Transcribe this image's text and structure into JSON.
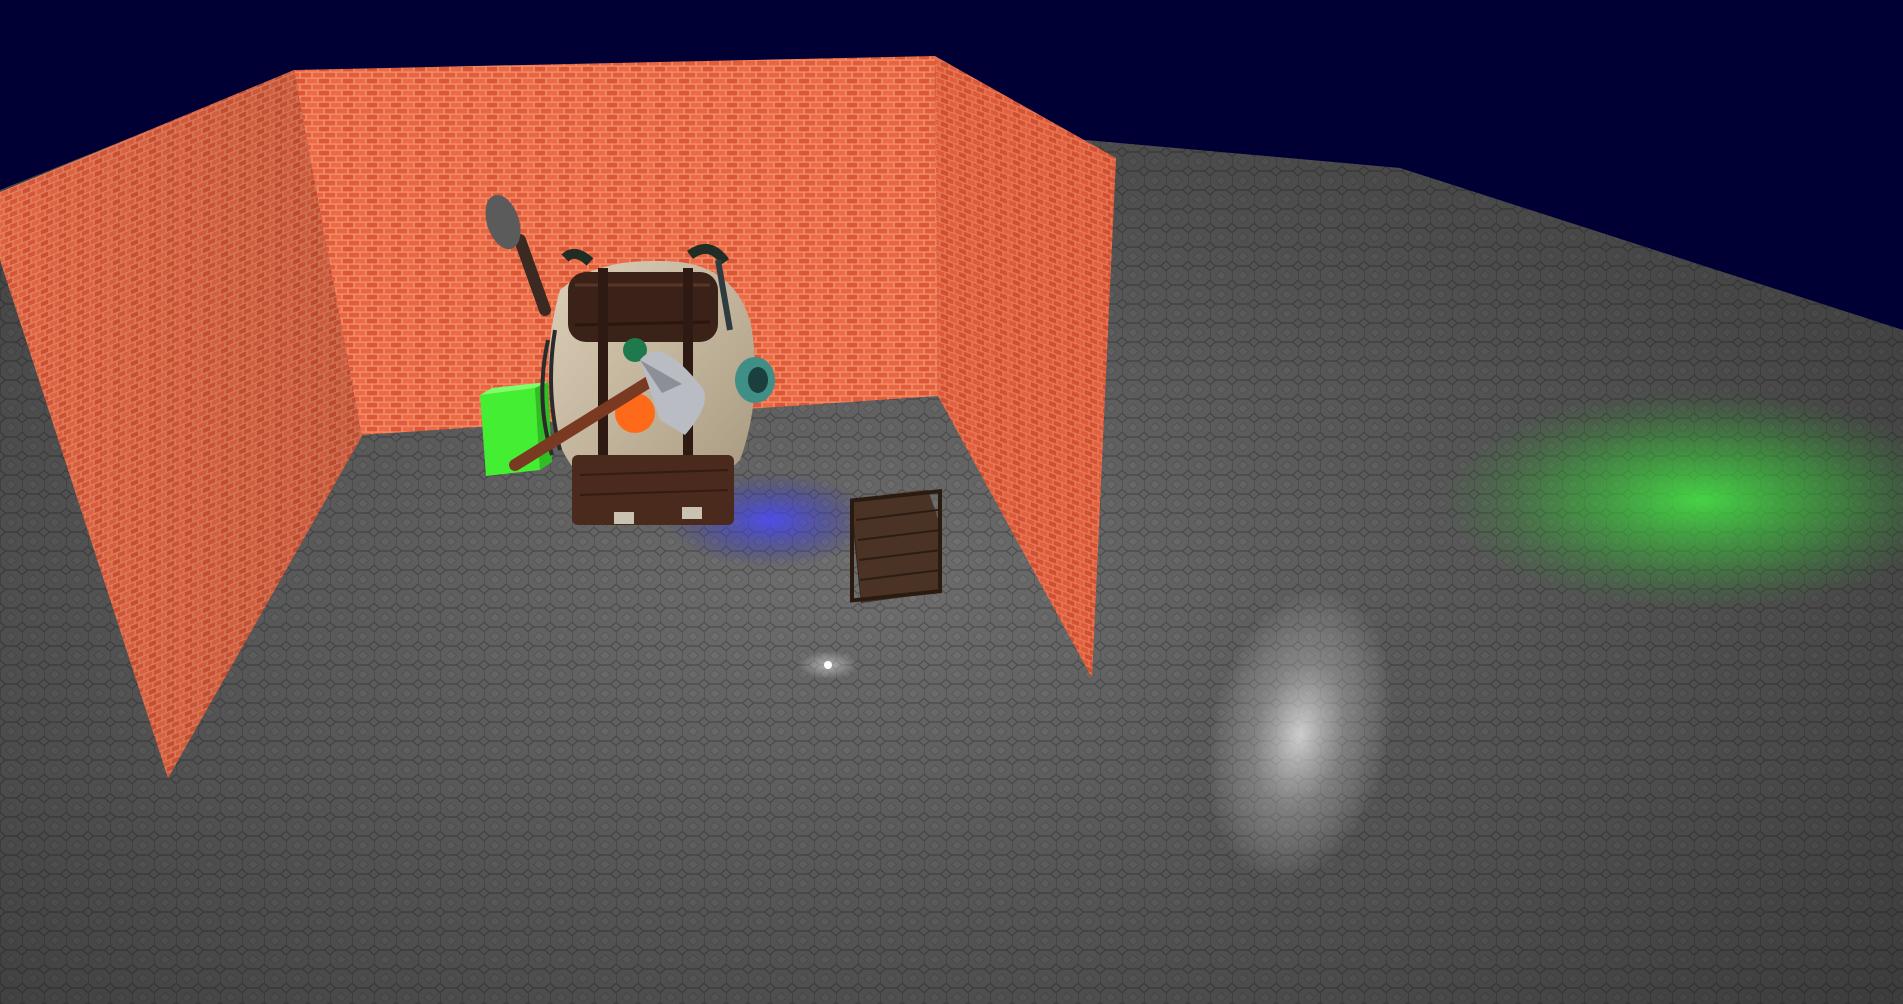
{
  "scene": {
    "sky_color": "#000035",
    "floor_color": "#6f6f6f",
    "floor_tile_color": "#5a5a5a",
    "brick_color": "#ee6440",
    "brick_mortar_color": "#f09a7c",
    "light_colors": {
      "blue": "#4a4aff",
      "green": "#44ff44",
      "white": "#ffffff"
    }
  },
  "objects": [
    {
      "name": "brick-wall-left",
      "kind": "wall"
    },
    {
      "name": "brick-wall-back",
      "kind": "wall"
    },
    {
      "name": "brick-wall-right",
      "kind": "wall"
    },
    {
      "name": "backpack-model",
      "kind": "prop"
    },
    {
      "name": "green-cube",
      "kind": "prop",
      "color": "#44ee33"
    },
    {
      "name": "wooden-crate",
      "kind": "prop",
      "color": "#4a3324"
    },
    {
      "name": "point-light-marker",
      "kind": "light"
    },
    {
      "name": "green-spot-light",
      "kind": "light"
    },
    {
      "name": "white-spot-light",
      "kind": "light"
    },
    {
      "name": "blue-point-light",
      "kind": "light"
    }
  ]
}
